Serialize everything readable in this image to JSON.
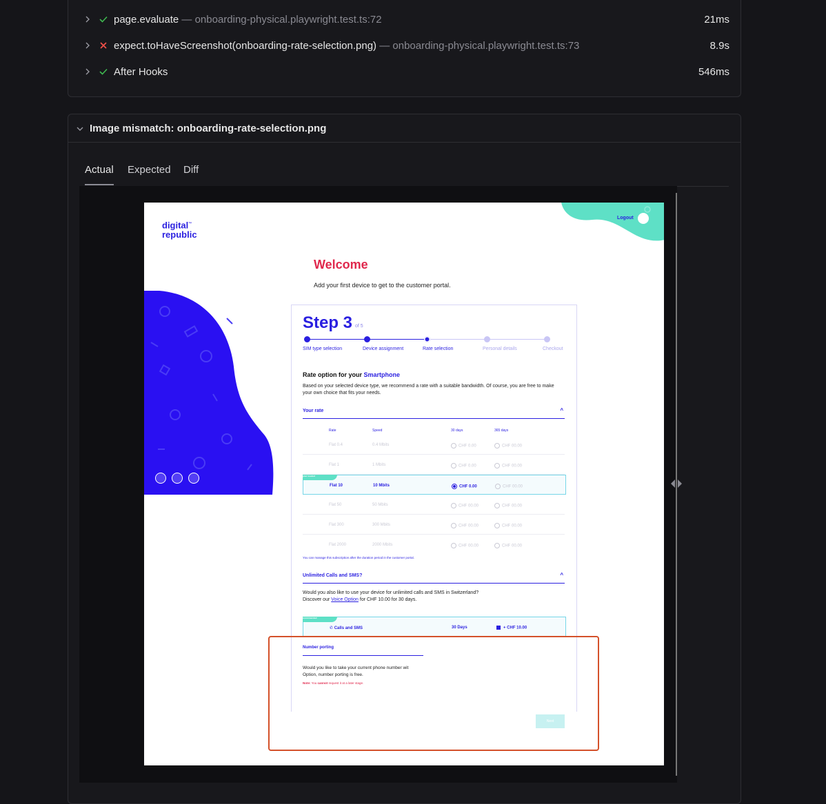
{
  "steps": [
    {
      "status": "pass",
      "title": "page.evaluate",
      "location": " — onboarding-physical.playwright.test.ts:72",
      "duration": "21ms"
    },
    {
      "status": "fail",
      "title": "expect.toHaveScreenshot(onboarding-rate-selection.png)",
      "location": " — onboarding-physical.playwright.test.ts:73",
      "duration": "8.9s"
    },
    {
      "status": "pass",
      "title": "After Hooks",
      "location": "",
      "duration": "546ms"
    }
  ],
  "mismatch": {
    "title": "Image mismatch: onboarding-rate-selection.png",
    "tabs": [
      "Actual",
      "Expected",
      "Diff"
    ],
    "active_tab": "Actual"
  },
  "shot": {
    "logo_line1": "digital",
    "logo_line2": "republic",
    "logout": "Logout",
    "welcome": "Welcome",
    "welcome_sub": "Add your first device to get to the customer portal.",
    "step_title": "Step 3",
    "step_of": "of 5",
    "progress": [
      "SIM type selection",
      "Device assignment",
      "Rate selection",
      "Personal details",
      "Checkout"
    ],
    "rate_title": "Rate option for your ",
    "rate_title_highlight": "Smartphone",
    "rate_desc": "Based on your selected device type, we recommend a rate with a suitable bandwidth. Of course, you are free to make your own choice that fits your needs.",
    "your_rate": "Your rate",
    "rate_columns": [
      "Rate",
      "Speed",
      "30 days",
      "365 days"
    ],
    "rates": [
      {
        "name": "Flat 0.4",
        "speed": "0.4 Mbits",
        "d30": "CHF 0.00",
        "d365": "CHF 00.00"
      },
      {
        "name": "Flat 1",
        "speed": "1 Mbits",
        "d30": "CHF 0.00",
        "d365": "CHF 00.00"
      },
      {
        "name": "Flat 10",
        "speed": "10 Mbits",
        "d30": "CHF 0.00",
        "d365": "CHF 00.00",
        "selected": true,
        "badge": "your needed"
      },
      {
        "name": "Flat 50",
        "speed": "50 Mbits",
        "d30": "CHF 00.00",
        "d365": "CHF 00.00"
      },
      {
        "name": "Flat 300",
        "speed": "300 Mbits",
        "d30": "CHF 00.00",
        "d365": "CHF 00.00"
      },
      {
        "name": "Flat 2000",
        "speed": "2000 Mbits",
        "d30": "CHF 00.00",
        "d365": "CHF 00.00"
      }
    ],
    "rate_note": "You can manage this subscription after the duration period in the customer portal.",
    "calls_title": "Unlimited Calls and SMS?",
    "calls_desc1": "Would you also like to use your device for unlimited calls and SMS in Switzerland?",
    "calls_desc2a": "Discover our ",
    "calls_desc2_link": "Voice Option",
    "calls_desc2b": " for CHF 10.00 for 30 days.",
    "calls_badge": "recommended",
    "calls_label": "Calls and SMS",
    "calls_days": "30 Days",
    "calls_price": "+ CHF 10.00",
    "np_title": "Number porting",
    "np_text1": "Would you like to take your current phone number wit",
    "np_text2": "Option, number porting is free.",
    "np_note_a": "Note:",
    "np_note_b": " You ",
    "np_note_c": "cannot",
    "np_note_d": " request it at a later stage.",
    "next": "Next"
  },
  "colors": {
    "pass": "#3fb950",
    "fail": "#f85149",
    "brand": "#2a1fe0",
    "accent": "#e0284d",
    "teal": "#5ee0c6",
    "mismatch": "#d4512a"
  }
}
